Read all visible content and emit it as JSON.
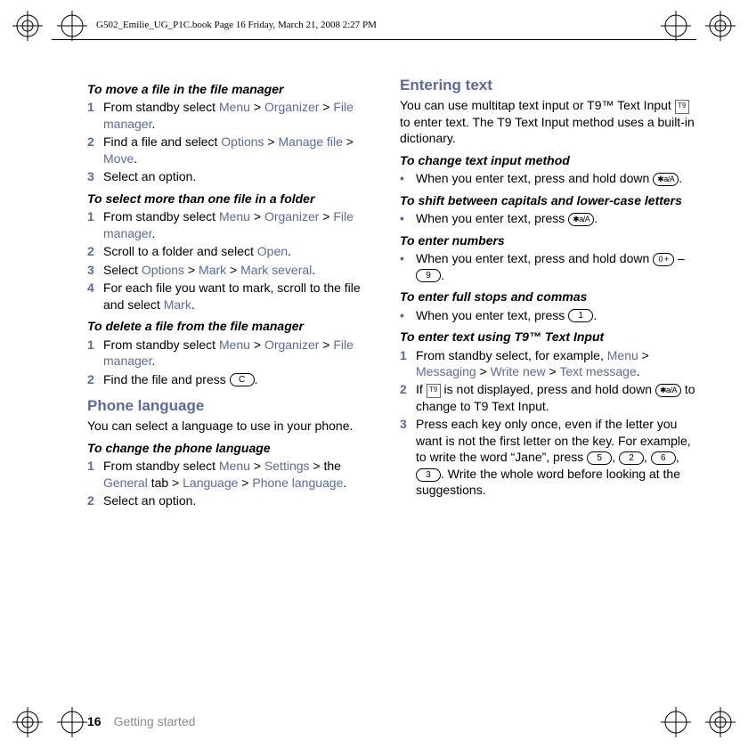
{
  "meta": {
    "print_header": "G502_Emilie_UG_P1C.book  Page 16  Friday, March 21, 2008  2:27 PM"
  },
  "left": {
    "s1": {
      "head": "To move a file in the file manager",
      "r1_a": "From standby select ",
      "r1_menu": "Menu",
      "r1_gt1": " > ",
      "r1_org": "Organizer",
      "r1_gt2": " > ",
      "r1_fm": "File manager",
      "r1_dot": ".",
      "r2_a": "Find a file and select ",
      "r2_opt": "Options",
      "r2_gt1": " > ",
      "r2_mf": "Manage file",
      "r2_gt2": " > ",
      "r2_mv": "Move",
      "r2_dot": ".",
      "r3": "Select an option."
    },
    "s2": {
      "head": "To select more than one file in a folder",
      "r1_a": "From standby select ",
      "r1_menu": "Menu",
      "r1_gt1": " > ",
      "r1_org": "Organizer",
      "r1_gt2": " > ",
      "r1_fm": "File manager",
      "r1_dot": ".",
      "r2_a": "Scroll to a folder and select ",
      "r2_open": "Open",
      "r2_dot": ".",
      "r3_a": "Select ",
      "r3_opt": "Options",
      "r3_gt1": " > ",
      "r3_mk": "Mark",
      "r3_gt2": " > ",
      "r3_ms": "Mark several",
      "r3_dot": ".",
      "r4_a": "For each file you want to mark, scroll to the file and select ",
      "r4_mk": "Mark",
      "r4_dot": "."
    },
    "s3": {
      "head": "To delete a file from the file manager",
      "r1_a": "From standby select ",
      "r1_menu": "Menu",
      "r1_gt1": " > ",
      "r1_org": "Organizer",
      "r1_gt2": " > ",
      "r1_fm": "File manager",
      "r1_dot": ".",
      "r2_a": "Find the file and press ",
      "r2_key": "C",
      "r2_dot": "."
    },
    "lang": {
      "head": "Phone language",
      "p": "You can select a language to use in your phone.",
      "sub": "To change the phone language",
      "r1_a": "From standby select ",
      "r1_menu": "Menu",
      "r1_gt1": " > ",
      "r1_set": "Settings",
      "r1_gt2": " > the ",
      "r1_gen": "General",
      "r1_gt3": " tab > ",
      "r1_lang": "Language",
      "r1_gt4": " > ",
      "r1_pl": "Phone language",
      "r1_dot": ".",
      "r2": "Select an option."
    }
  },
  "right": {
    "enter": {
      "head": "Entering text",
      "p_a": "You can use multitap text input or T9™ Text Input ",
      "p_b": " to enter text. The T9 Text Input method uses a built-in dictionary."
    },
    "change": {
      "head": "To change text input method",
      "b_a": "When you enter text, press and hold down ",
      "b_key": "✱a/A",
      "b_dot": "."
    },
    "shift": {
      "head": "To shift between capitals and lower-case letters",
      "b_a": "When you enter text, press ",
      "b_key": "✱a/A",
      "b_dot": "."
    },
    "num": {
      "head": "To enter numbers",
      "b_a": "When you enter text, press and hold down ",
      "k1": "0 +",
      "dash": " – ",
      "k2": "9",
      "b_dot": "."
    },
    "stops": {
      "head": "To enter full stops and commas",
      "b_a": "When you enter text, press ",
      "k": "1",
      "b_dot": "."
    },
    "t9": {
      "head": "To enter text using T9™ Text Input",
      "r1_a": "From standby select, for example, ",
      "r1_menu": "Menu",
      "r1_gt1": " > ",
      "r1_msg": "Messaging",
      "r1_gt2": " > ",
      "r1_wn": "Write new",
      "r1_gt3": " > ",
      "r1_tm": "Text message",
      "r1_dot": ".",
      "r2_a": "If ",
      "r2_b": " is not displayed, press and hold down ",
      "r2_key": "✱a/A",
      "r2_c": " to change to T9 Text Input.",
      "r3_a": "Press each key only once, even if the letter you want is not the first letter on the key. For example, to write the word “Jane”, press ",
      "k5": "5",
      "c1": ", ",
      "k2": "2",
      "c2": ", ",
      "k6": "6",
      "c3": ", ",
      "k3": "3",
      "r3_b": ". Write the whole word before looking at the suggestions."
    }
  },
  "footer": {
    "page": "16",
    "section": "Getting started"
  },
  "nums": {
    "n1": "1",
    "n2": "2",
    "n3": "3",
    "n4": "4"
  },
  "bullets": {
    "dot": "•"
  },
  "t9label": "T9"
}
